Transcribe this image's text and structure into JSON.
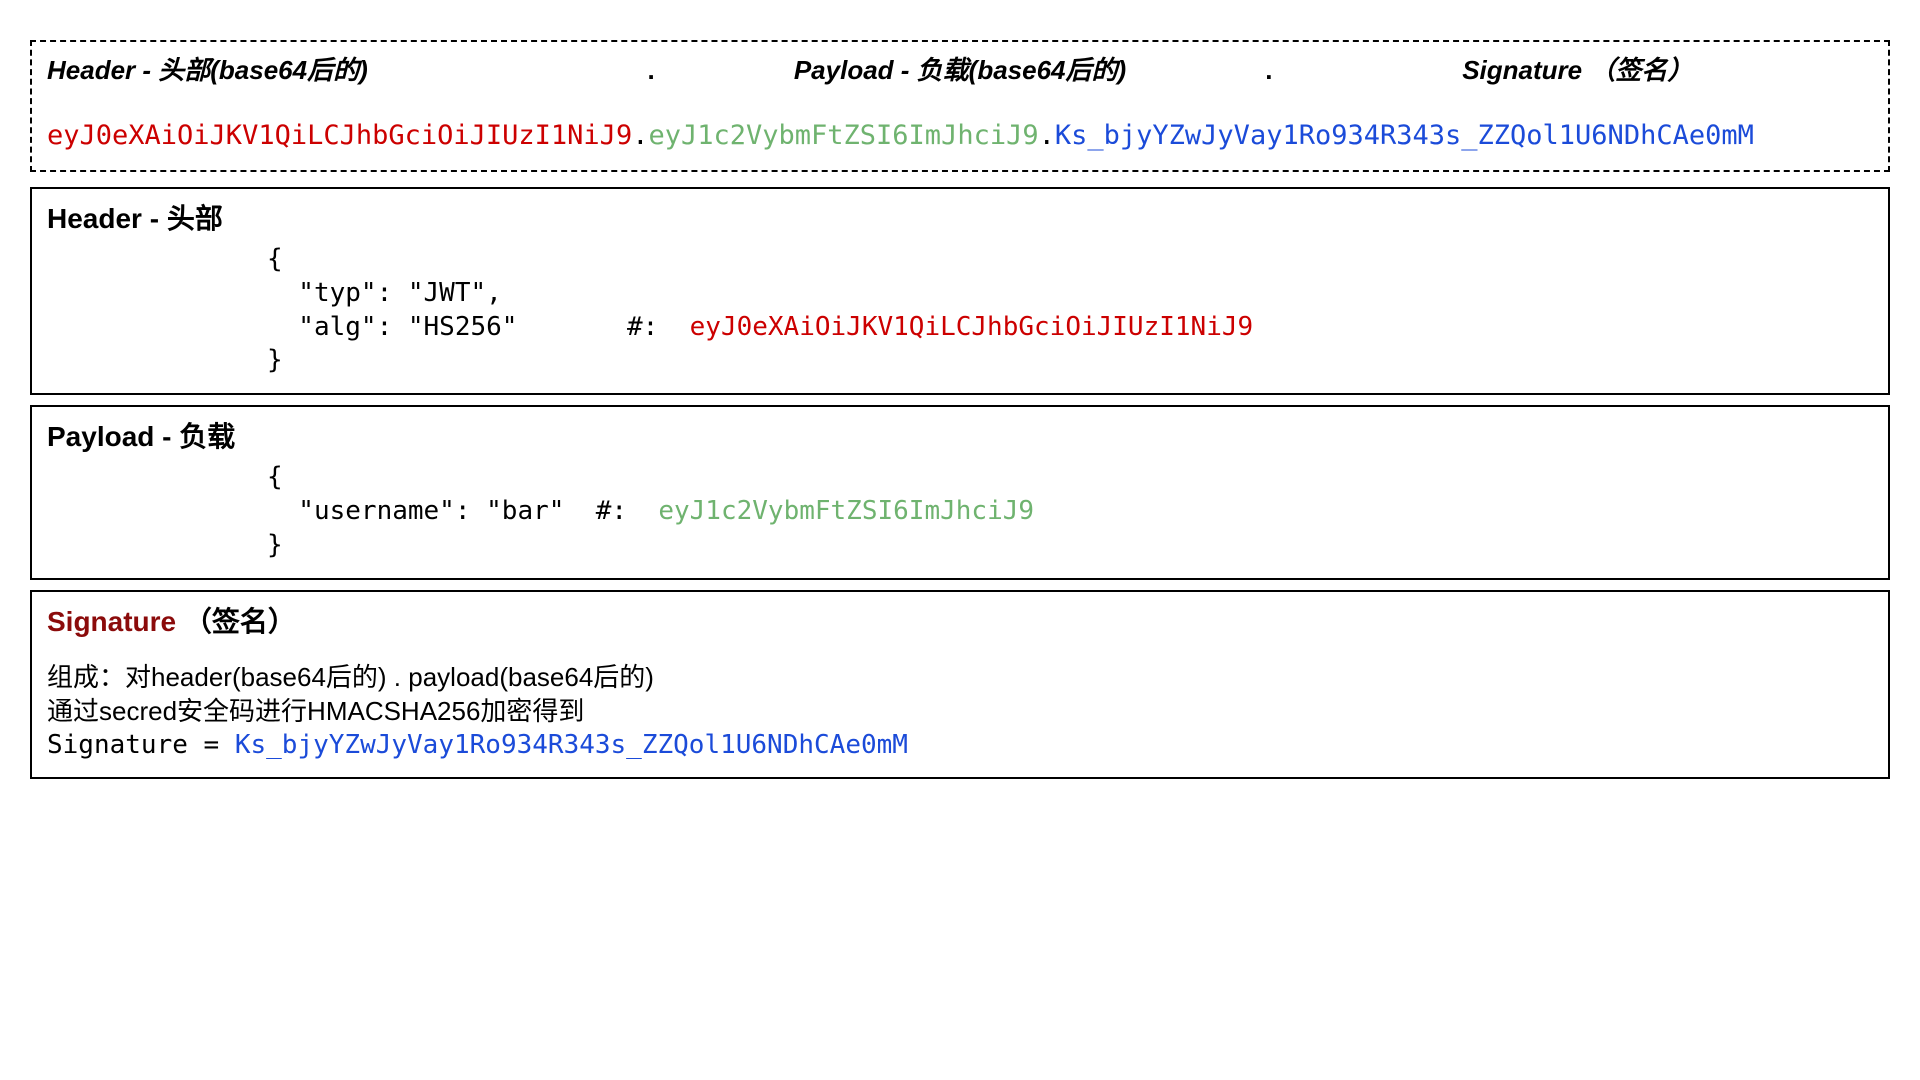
{
  "top": {
    "header_label": "Header - 头部(base64后的)",
    "payload_label": "Payload - 负载(base64后的)",
    "signature_label": "Signature （签名）",
    "dot": ".",
    "jwt": {
      "header": "eyJ0eXAiOiJKV1QiLCJhbGciOiJIUzI1NiJ9",
      "payload": "eyJ1c2VybmFtZSI6ImJhciJ9",
      "signature": "Ks_bjyYZwJyVay1Ro934R343s_ZZQol1U6NDhCAe0mM"
    }
  },
  "header_section": {
    "title": "Header - 头部",
    "line_open": "{",
    "line_typ": "  \"typ\": \"JWT\",",
    "line_alg_prefix": "  \"alg\": \"HS256\"       #:  ",
    "encoded": "eyJ0eXAiOiJKV1QiLCJhbGciOiJIUzI1NiJ9",
    "line_close": "}"
  },
  "payload_section": {
    "title": "Payload - 负载",
    "line_open": "{",
    "line_user_prefix": "  \"username\": \"bar\"  #:  ",
    "encoded": "eyJ1c2VybmFtZSI6ImJhciJ9",
    "line_close": "}"
  },
  "signature_section": {
    "title": "Signature （签名）",
    "desc1": "组成：对header(base64后的) . payload(base64后的)",
    "desc2": "通过secred安全码进行HMACSHA256加密得到",
    "eq_prefix": " Signature  = ",
    "eq_value": "Ks_bjyYZwJyVay1Ro934R343s_ZZQol1U6NDhCAe0mM"
  }
}
